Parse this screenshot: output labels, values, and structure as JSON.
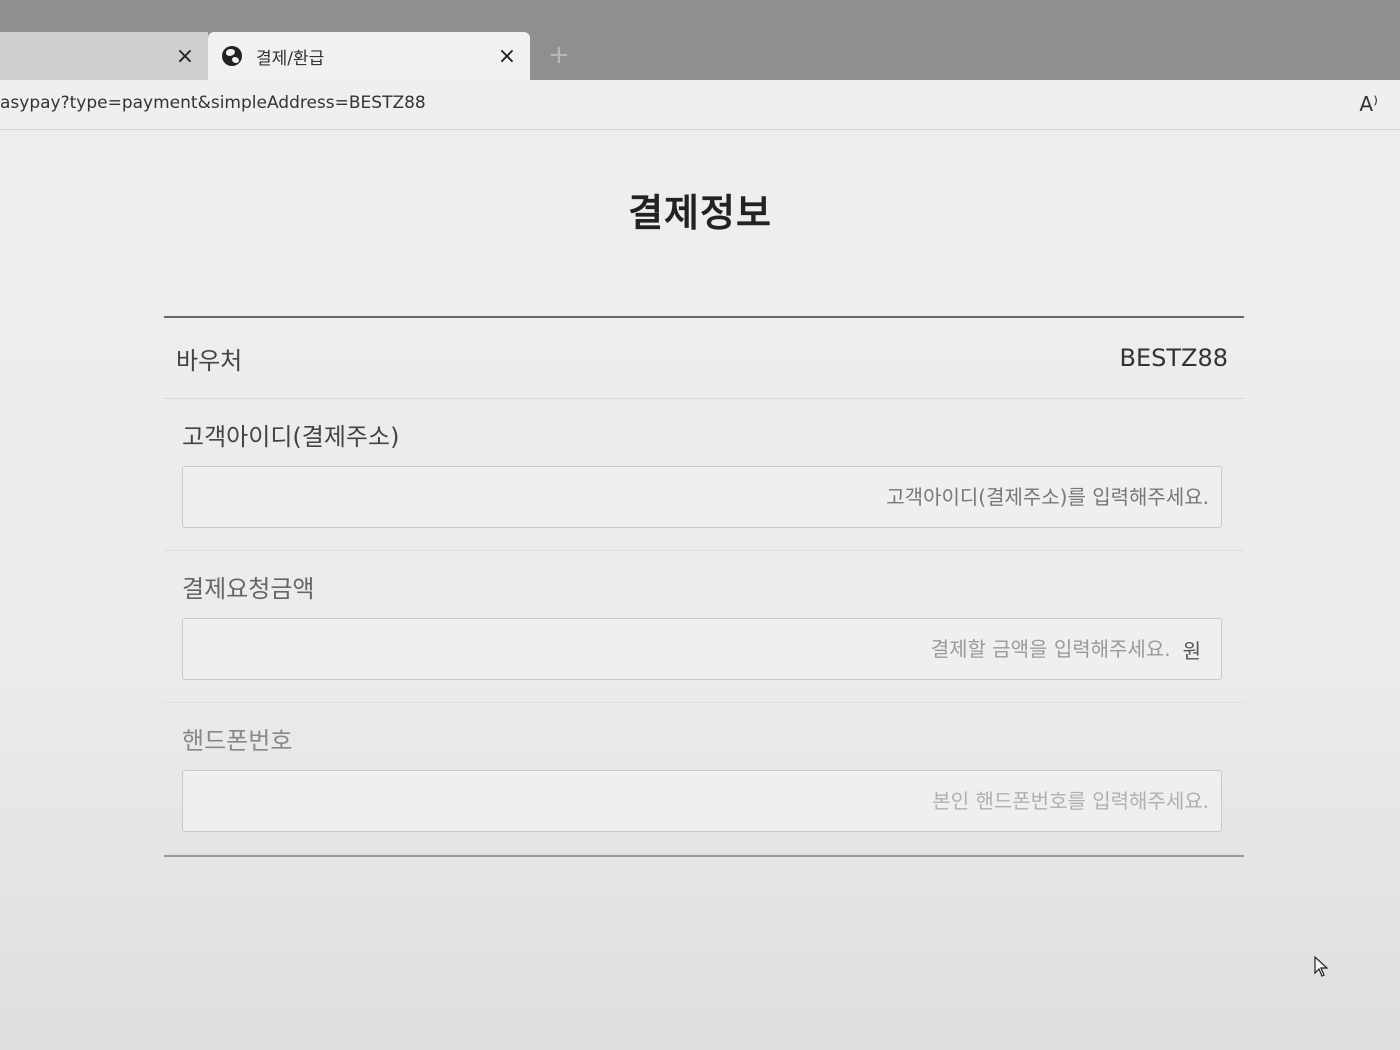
{
  "browser": {
    "tabs": [
      {
        "title": "",
        "close_label": "×"
      },
      {
        "title": "결제/환급",
        "close_label": "×"
      }
    ],
    "new_tab_label": "+",
    "url": "asypay?type=payment&simpleAddress=BESTZ88",
    "read_aloud_label": "A⁾"
  },
  "page": {
    "title": "결제정보",
    "voucher": {
      "label": "바우처",
      "value": "BESTZ88"
    },
    "fields": [
      {
        "label": "고객아이디(결제주소)",
        "placeholder": "고객아이디(결제주소)를 입력해주세요.",
        "value": ""
      },
      {
        "label": "결제요청금액",
        "placeholder": "결제할 금액을 입력해주세요.",
        "value": "",
        "unit": "원"
      },
      {
        "label": "핸드폰번호",
        "placeholder": "본인 핸드폰번호를 입력해주세요.",
        "value": ""
      }
    ]
  }
}
